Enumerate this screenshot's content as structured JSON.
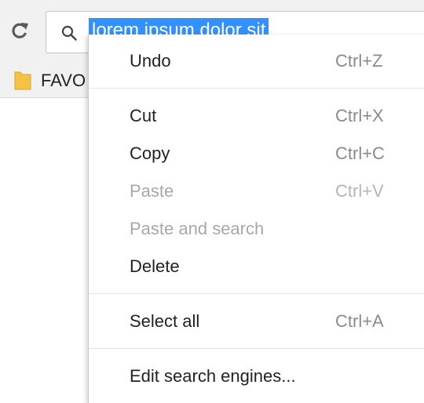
{
  "omnibox": {
    "selected_text": "lorem ipsum dolor sit"
  },
  "bookmarks": {
    "folder_label": "FAVO"
  },
  "context_menu": {
    "items": [
      {
        "label": "Undo",
        "shortcut": "Ctrl+Z",
        "enabled": true
      },
      {
        "label": "Cut",
        "shortcut": "Ctrl+X",
        "enabled": true
      },
      {
        "label": "Copy",
        "shortcut": "Ctrl+C",
        "enabled": true
      },
      {
        "label": "Paste",
        "shortcut": "Ctrl+V",
        "enabled": false
      },
      {
        "label": "Paste and search",
        "shortcut": "",
        "enabled": false
      },
      {
        "label": "Delete",
        "shortcut": "",
        "enabled": true
      },
      {
        "label": "Select all",
        "shortcut": "Ctrl+A",
        "enabled": true
      },
      {
        "label": "Edit search engines...",
        "shortcut": "",
        "enabled": true
      }
    ]
  },
  "icons": {
    "reload": "reload-icon",
    "search": "search-icon",
    "bookmark_folder": "folder-icon"
  },
  "colors": {
    "selection_highlight": "#3390ff",
    "menu_text": "#222222",
    "menu_disabled_text": "#a8a8a8",
    "shortcut_text": "#8a8a8a",
    "folder": "#f5c242"
  }
}
